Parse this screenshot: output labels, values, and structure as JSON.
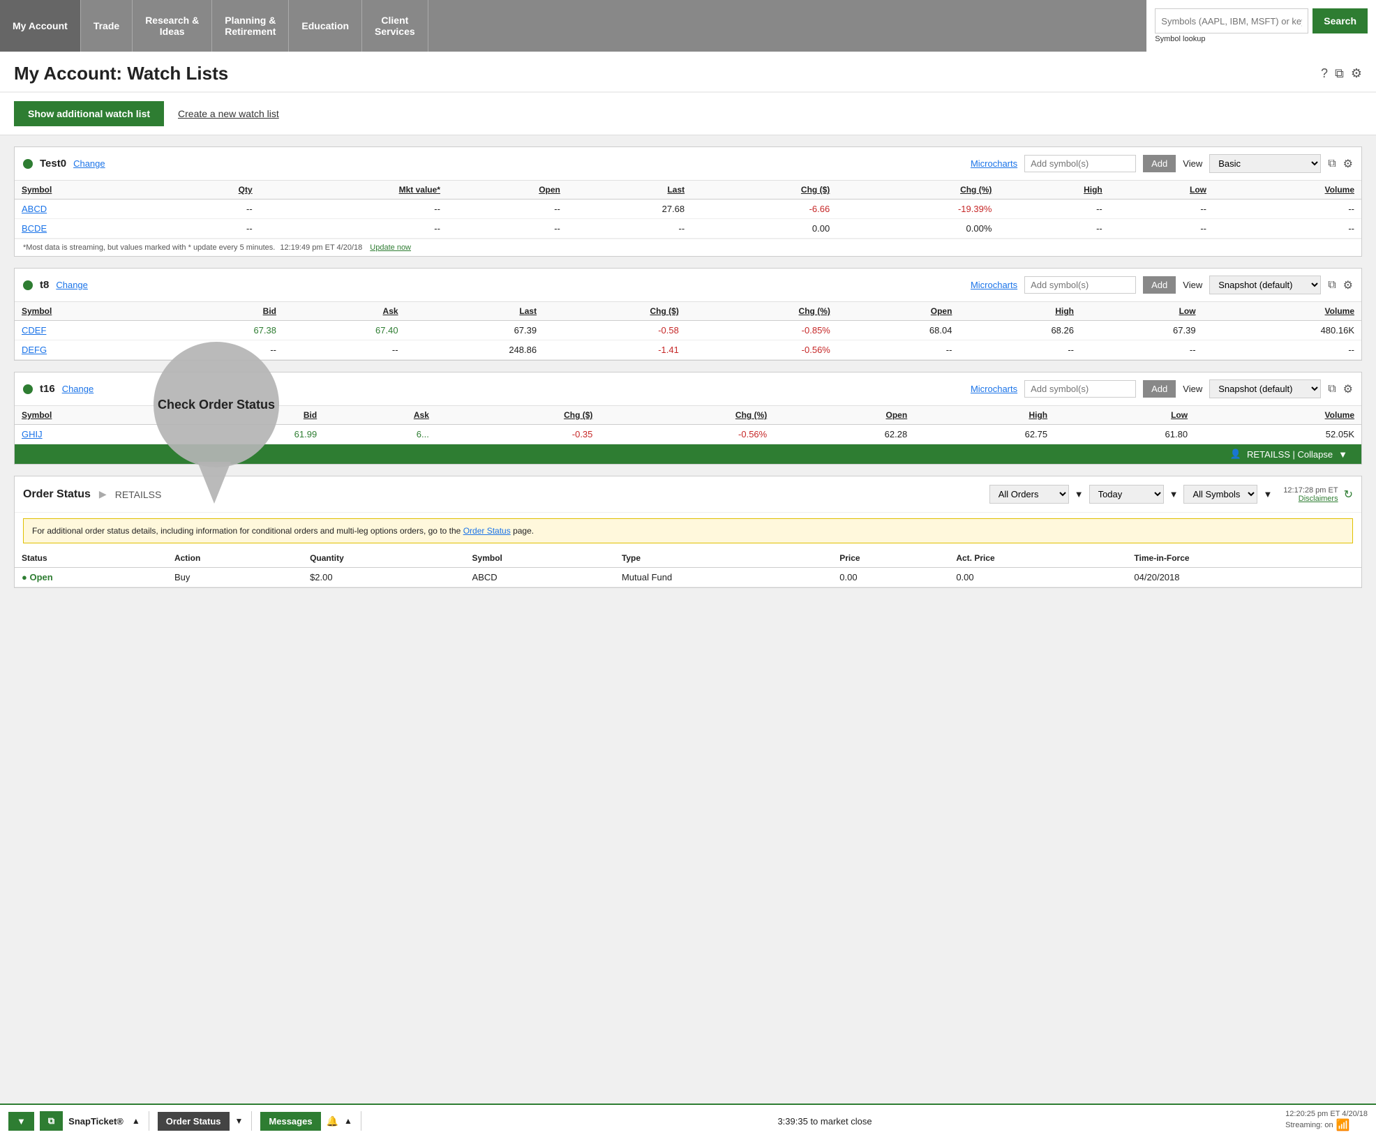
{
  "nav": {
    "items": [
      {
        "label": "My Account",
        "active": true
      },
      {
        "label": "Trade",
        "active": false
      },
      {
        "label": "Research &\nIdeas",
        "active": false
      },
      {
        "label": "Planning &\nRetirement",
        "active": false
      },
      {
        "label": "Education",
        "active": false
      },
      {
        "label": "Client\nServices",
        "active": false
      }
    ],
    "search_placeholder": "Symbols (AAPL, IBM, MSFT) or keywords",
    "search_label": "Search",
    "symbol_lookup": "Symbol lookup"
  },
  "page": {
    "title": "My Account: Watch Lists",
    "icons": [
      "?",
      "⧉",
      "⚙"
    ]
  },
  "actions": {
    "show_watchlist": "Show additional watch list",
    "create_watchlist": "Create a new watch list"
  },
  "watchlists": [
    {
      "id": "test0",
      "name": "Test0",
      "view": "Basic",
      "columns_basic": [
        "Symbol",
        "Qty",
        "Mkt value*",
        "Open",
        "Last",
        "Chg ($)",
        "Chg (%)",
        "High",
        "Low",
        "Volume"
      ],
      "rows": [
        {
          "symbol": "ABCD",
          "qty": "--",
          "mkt_value": "--",
          "open": "--",
          "last": "27.68",
          "chg_dollar": "-6.66",
          "chg_pct": "-19.39%",
          "high": "--",
          "low": "--",
          "volume": "--",
          "neg": true
        },
        {
          "symbol": "BCDE",
          "qty": "--",
          "mkt_value": "--",
          "open": "--",
          "last": "--",
          "chg_dollar": "0.00",
          "chg_pct": "0.00%",
          "high": "--",
          "low": "--",
          "volume": "--",
          "neg": false
        }
      ],
      "footer": "*Most data is streaming, but values marked with * update every 5 minutes.",
      "footer_time": "12:19:49 pm ET 4/20/18",
      "update_now": "Update now"
    },
    {
      "id": "t8",
      "name": "t8",
      "view": "Snapshot (default)",
      "columns_snapshot": [
        "Symbol",
        "Bid",
        "Ask",
        "Last",
        "Chg ($)",
        "Chg (%)",
        "Open",
        "High",
        "Low",
        "Volume"
      ],
      "rows": [
        {
          "symbol": "CDEF",
          "bid": "67.38",
          "ask": "67.40",
          "last": "67.39",
          "chg_dollar": "-0.58",
          "chg_pct": "-0.85%",
          "open": "68.04",
          "high": "68.26",
          "low": "67.39",
          "volume": "480.16K",
          "neg": true,
          "bid_green": true,
          "ask_green": true
        },
        {
          "symbol": "DEFG",
          "bid": "--",
          "ask": "--",
          "last": "248.86",
          "chg_dollar": "-1.41",
          "chg_pct": "-0.56%",
          "open": "--",
          "high": "--",
          "low": "--",
          "volume": "--",
          "neg": true,
          "bid_green": false,
          "ask_green": false
        }
      ],
      "footer": null
    },
    {
      "id": "t16",
      "name": "t16",
      "view": "Snapshot (default)",
      "columns_snapshot": [
        "Symbol",
        "Bid",
        "Ask",
        "Chg ($)",
        "Chg (%)",
        "Open",
        "High",
        "Low",
        "Volume"
      ],
      "rows": [
        {
          "symbol": "GHIJ",
          "bid": "61.99",
          "ask": "6...",
          "chg_dollar": "-0.35",
          "chg_pct": "-0.56%",
          "open": "62.28",
          "high": "62.75",
          "low": "61.80",
          "volume": "52.05K",
          "neg": true,
          "bid_green": true,
          "ask_green": true
        }
      ],
      "footer": null
    }
  ],
  "order_status": {
    "bar_label": "RETAILSS | Collapse",
    "title": "Order Status",
    "account": "RETAILSS",
    "filter_options": [
      "All Orders",
      "Today",
      "All Symbols"
    ],
    "time": "12:17:28 pm ET",
    "disclaimers": "Disclaimers",
    "notice": "For additional order status details, including information for conditional orders and multi-leg options orders, go to the",
    "notice_link": "Order Status",
    "notice_end": "page.",
    "columns": [
      "Status",
      "Action",
      "Quantity",
      "Symbol",
      "Type",
      "Price",
      "Act. Price",
      "Time-in-Force"
    ],
    "rows": [
      {
        "status": "Open",
        "action": "Buy",
        "quantity": "$2.00",
        "symbol": "ABCD",
        "type": "Mutual Fund",
        "price": "0.00",
        "act_price": "0.00",
        "tif": "04/20/2018"
      }
    ]
  },
  "tooltip": {
    "text": "Check Order Status"
  },
  "bottom_bar": {
    "snap_label": "SnapTicket®",
    "order_status_label": "Order Status",
    "messages_label": "Messages",
    "market_close": "3:39:35 to market close",
    "time": "12:20:25 pm ET 4/20/18",
    "streaming": "Streaming: on"
  }
}
